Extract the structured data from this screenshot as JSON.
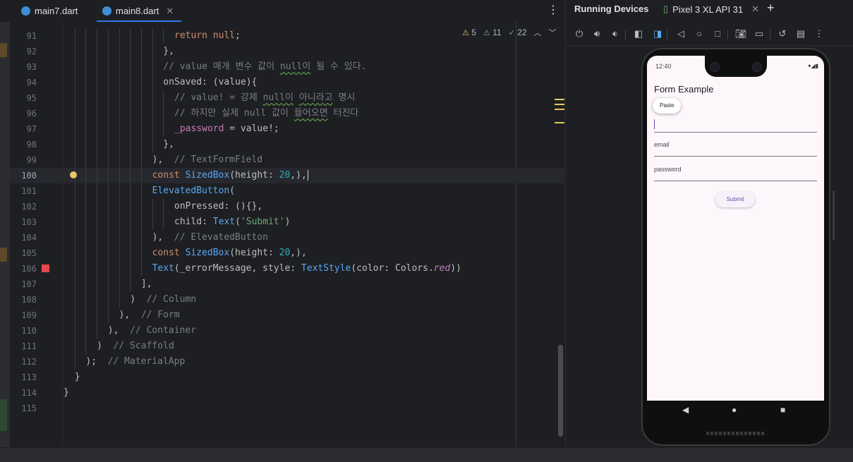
{
  "editor": {
    "tabs": [
      {
        "label": "main7.dart",
        "active": false
      },
      {
        "label": "main8.dart",
        "active": true
      }
    ],
    "inspections": {
      "warnings": "5",
      "weak_warnings": "11",
      "typos": "22"
    },
    "lines": [
      {
        "n": "91",
        "indent": 20,
        "tokens": [
          [
            "kw",
            "return"
          ],
          [
            "",
            " "
          ],
          [
            "kw",
            "null"
          ],
          [
            "",
            ";"
          ]
        ]
      },
      {
        "n": "92",
        "indent": 18,
        "tokens": [
          [
            "",
            "},"
          ]
        ]
      },
      {
        "n": "93",
        "indent": 18,
        "tokens": [
          [
            "cm",
            "// value 매개 변수 값이 "
          ],
          [
            "cm wavy",
            "null이"
          ],
          [
            "cm",
            " 될 수 있다."
          ]
        ]
      },
      {
        "n": "94",
        "indent": 18,
        "tokens": [
          [
            "",
            "onSaved: (value){"
          ]
        ]
      },
      {
        "n": "95",
        "indent": 20,
        "tokens": [
          [
            "cm",
            "// value! = 강제 "
          ],
          [
            "cm wavy",
            "null이"
          ],
          [
            "cm",
            " "
          ],
          [
            "cm wavy",
            "아니라고"
          ],
          [
            "cm",
            " 명시"
          ]
        ]
      },
      {
        "n": "96",
        "indent": 20,
        "tokens": [
          [
            "cm",
            "// 하지만 실제 null 값이 "
          ],
          [
            "cm wavy",
            "들어오면"
          ],
          [
            "cm",
            " 터진다"
          ]
        ]
      },
      {
        "n": "97",
        "indent": 20,
        "tokens": [
          [
            "pv",
            "_password"
          ],
          [
            "",
            " = value!;"
          ]
        ]
      },
      {
        "n": "98",
        "indent": 18,
        "tokens": [
          [
            "",
            "},"
          ]
        ]
      },
      {
        "n": "99",
        "indent": 16,
        "tokens": [
          [
            "",
            "),  "
          ],
          [
            "cm",
            "// TextFormField"
          ]
        ]
      },
      {
        "n": "100",
        "indent": 16,
        "current": true,
        "tokens": [
          [
            "kw",
            "const"
          ],
          [
            "",
            " "
          ],
          [
            "cls",
            "SizedBox"
          ],
          [
            "",
            "(height: "
          ],
          [
            "num",
            "20"
          ],
          [
            "",
            ",),"
          ]
        ]
      },
      {
        "n": "101",
        "indent": 16,
        "tokens": [
          [
            "cls",
            "ElevatedButton"
          ],
          [
            "",
            "("
          ]
        ]
      },
      {
        "n": "102",
        "indent": 20,
        "tokens": [
          [
            "",
            "onPressed: (){},"
          ]
        ]
      },
      {
        "n": "103",
        "indent": 20,
        "tokens": [
          [
            "",
            "child: "
          ],
          [
            "cls",
            "Text"
          ],
          [
            "",
            "("
          ],
          [
            "str",
            "'Submit'"
          ],
          [
            "",
            ")"
          ]
        ]
      },
      {
        "n": "104",
        "indent": 16,
        "tokens": [
          [
            "",
            "),  "
          ],
          [
            "cm",
            "// ElevatedButton"
          ]
        ]
      },
      {
        "n": "105",
        "indent": 16,
        "tokens": [
          [
            "kw",
            "const"
          ],
          [
            "",
            " "
          ],
          [
            "cls",
            "SizedBox"
          ],
          [
            "",
            "(height: "
          ],
          [
            "num",
            "20"
          ],
          [
            "",
            ",),"
          ]
        ]
      },
      {
        "n": "106",
        "indent": 16,
        "tokens": [
          [
            "cls",
            "Text"
          ],
          [
            "",
            "(_errorMessage, style: "
          ],
          [
            "cls",
            "TextStyle"
          ],
          [
            "",
            "(color: Colors."
          ],
          [
            "it",
            "red"
          ],
          [
            "",
            "))"
          ]
        ]
      },
      {
        "n": "107",
        "indent": 14,
        "tokens": [
          [
            "",
            "],"
          ]
        ]
      },
      {
        "n": "108",
        "indent": 12,
        "tokens": [
          [
            "",
            ")  "
          ],
          [
            "cm",
            "// Column"
          ]
        ]
      },
      {
        "n": "109",
        "indent": 10,
        "tokens": [
          [
            "",
            "),  "
          ],
          [
            "cm",
            "// Form"
          ]
        ]
      },
      {
        "n": "110",
        "indent": 8,
        "tokens": [
          [
            "",
            "),  "
          ],
          [
            "cm",
            "// Container"
          ]
        ]
      },
      {
        "n": "111",
        "indent": 6,
        "tokens": [
          [
            "",
            ")  "
          ],
          [
            "cm",
            "// Scaffold"
          ]
        ]
      },
      {
        "n": "112",
        "indent": 4,
        "tokens": [
          [
            "",
            ");  "
          ],
          [
            "cm",
            "// MaterialApp"
          ]
        ]
      },
      {
        "n": "113",
        "indent": 2,
        "tokens": [
          [
            "",
            "}"
          ]
        ]
      },
      {
        "n": "114",
        "indent": 0,
        "tokens": [
          [
            "",
            "}"
          ]
        ]
      },
      {
        "n": "115",
        "indent": 0,
        "tokens": []
      }
    ]
  },
  "devices": {
    "title": "Running Devices",
    "device_tab": "Pixel 3 XL API 31",
    "toolbar_icons": [
      "power-icon",
      "volume-up-icon",
      "volume-down-icon",
      "rotate-left-icon",
      "rotate-right-icon",
      "back-icon",
      "home-icon",
      "overview-icon",
      "screenshot-icon",
      "screen-record-icon",
      "reset-icon",
      "snapshot-icon",
      "more-icon"
    ],
    "phone": {
      "status_time": "12:40",
      "app_title": "Form Example",
      "paste_label": "Paste",
      "fields": [
        {
          "label": "",
          "focused": true
        },
        {
          "label": "email",
          "focused": false
        },
        {
          "label": "password",
          "focused": false
        }
      ],
      "submit_label": "Submit"
    }
  },
  "colors": {
    "accent": "#3574f0",
    "flutter_primary": "#6750a4",
    "error_marker": "#e5484d"
  }
}
